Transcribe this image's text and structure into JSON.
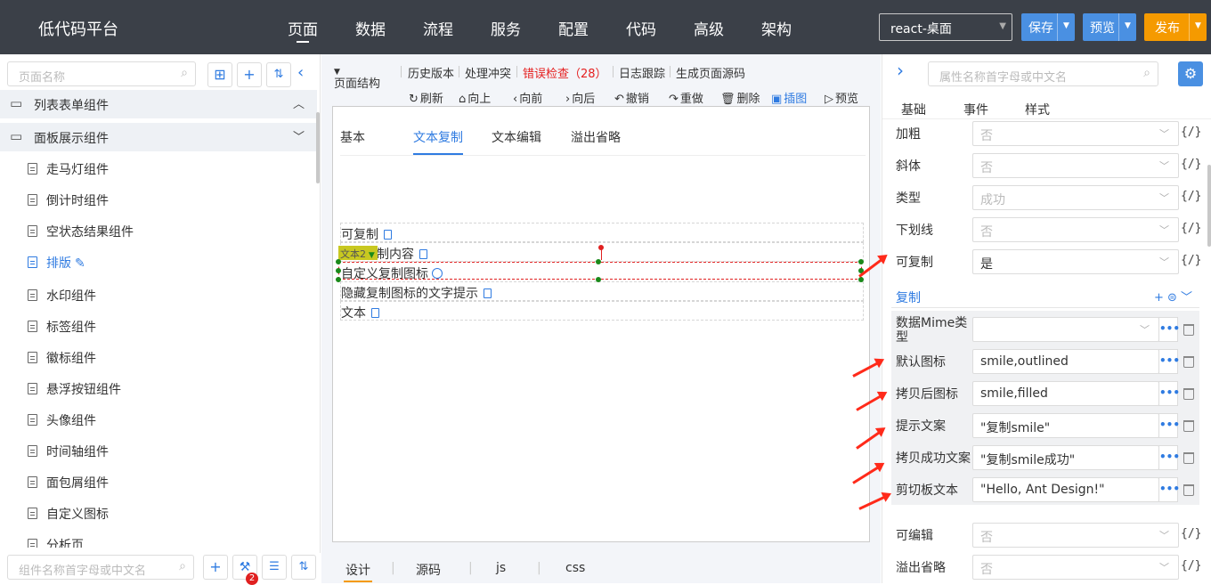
{
  "app": {
    "title": "低代码平台"
  },
  "nav": [
    "页面",
    "数据",
    "流程",
    "服务",
    "配置",
    "代码",
    "高级",
    "架构"
  ],
  "platform": "react-桌面",
  "actions": {
    "save": "保存",
    "preview": "预览",
    "publish": "发布"
  },
  "colors": {
    "accent": "#2f7be1",
    "publish": "#f59a00",
    "error": "#e52020",
    "topbar": "#3b4048"
  },
  "left": {
    "search_placeholder": "页面名称",
    "groups": [
      "列表表单组件",
      "面板展示组件"
    ],
    "items": [
      "走马灯组件",
      "倒计时组件",
      "空状态结果组件",
      "排版",
      "水印组件",
      "标签组件",
      "徽标组件",
      "悬浮按钮组件",
      "头像组件",
      "时间轴组件",
      "面包屑组件",
      "自定义图标",
      "分析页"
    ],
    "active_item": "排版",
    "bottom_search_placeholder": "组件名称首字母或中文名",
    "badge_count": "2"
  },
  "center": {
    "toolbar": [
      "页面结构",
      "历史版本",
      "处理冲突",
      "错误检查（28）",
      "日志跟踪",
      "生成页面源码"
    ],
    "actions": [
      "刷新",
      "向上",
      "向前",
      "向后",
      "撤销",
      "重做",
      "删除",
      "插图",
      "预览"
    ],
    "tabs": [
      "基本",
      "文本复制",
      "文本编辑",
      "溢出省略"
    ],
    "active_tab": "文本复制",
    "rows": [
      "可复制",
      "制内容",
      "自定义复制图标",
      "隐藏复制图标的文字提示",
      "文本"
    ],
    "selected_tag": "文本2",
    "bottom_tabs": [
      "设计",
      "源码",
      "js",
      "css"
    ]
  },
  "right": {
    "search_placeholder": "属性名称首字母或中文名",
    "tabs": [
      "基础",
      "事件",
      "样式"
    ],
    "props": [
      {
        "label": "加粗",
        "value": "否"
      },
      {
        "label": "斜体",
        "value": "否"
      },
      {
        "label": "类型",
        "value": "成功"
      },
      {
        "label": "下划线",
        "value": "否"
      },
      {
        "label": "可复制",
        "value": "是"
      }
    ],
    "copy_section": "复制",
    "copy_props": [
      {
        "label": "数据Mime类型",
        "value": ""
      },
      {
        "label": "默认图标",
        "value": "smile,outlined"
      },
      {
        "label": "拷贝后图标",
        "value": "smile,filled"
      },
      {
        "label": "提示文案",
        "value": "\"复制smile\""
      },
      {
        "label": "拷贝成功文案",
        "value": "\"复制smile成功\""
      },
      {
        "label": "剪切板文本",
        "value": "\"Hello, Ant Design!\""
      }
    ],
    "more_props": [
      {
        "label": "可编辑",
        "value": "否"
      },
      {
        "label": "溢出省略",
        "value": "否"
      }
    ],
    "fx_label": "{/}"
  }
}
